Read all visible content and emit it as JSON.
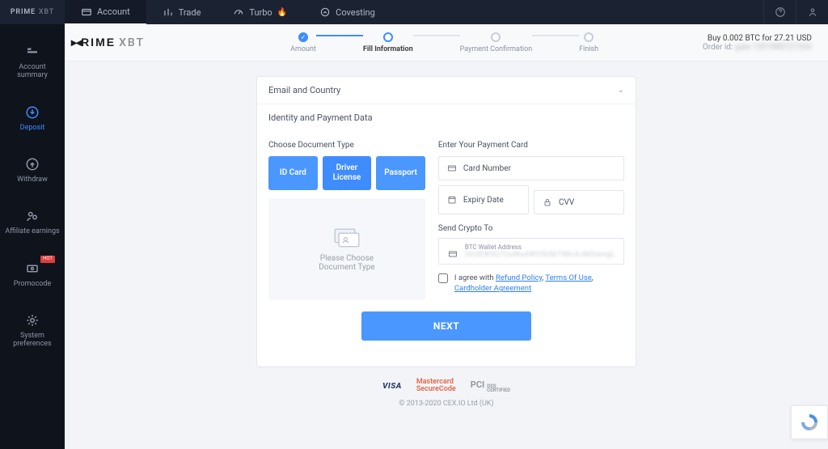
{
  "brand_top": {
    "p": "PRIME",
    "suffix": "XBT"
  },
  "topnav": {
    "account": "Account",
    "trade": "Trade",
    "turbo": "Turbo",
    "covesting": "Covesting"
  },
  "sidebar": {
    "summary": "Account\nsummary",
    "deposit": "Deposit",
    "withdraw": "Withdraw",
    "affiliate": "Affiliate earnings",
    "promo": "Promocode",
    "sys": "System\npreferences"
  },
  "logo_main": {
    "prime": "PRIME",
    "xbt": "XBT"
  },
  "stepper": {
    "s1": "Amount",
    "s2": "Fill Information",
    "s3": "Payment Confirmation",
    "s4": "Finish"
  },
  "order": {
    "buy": "Buy 0.002 BTC for 27.21 USD",
    "id_label": "Order id:",
    "id_val": "gate 1591880727350"
  },
  "sections": {
    "email_country": "Email and Country",
    "identity": "Identity and Payment Data"
  },
  "identity": {
    "doc_heading": "Choose Document Type",
    "card_heading": "Enter Your Payment Card",
    "id_card": "ID Card",
    "driver": "Driver\nLicense",
    "passport": "Passport",
    "placeholder_msg": "Please Choose\nDocument Type",
    "card_number": "Card Number",
    "expiry": "Expiry Date",
    "cvv": "CVV",
    "send_to": "Send Crypto To",
    "wallet_label": "BTC Wallet Address",
    "wallet_val": "3A3EW3U7cuWuAWtVb5bT8KrAJMOwngL",
    "agree_pre": "I agree with ",
    "refund": "Refund Policy",
    "tos": "Terms Of Use",
    "cardholder": "Cardholder Agreement"
  },
  "next": "NEXT",
  "footer": {
    "visa": "VISA",
    "mc1": "Mastercard",
    "mc2": "SecureCode",
    "pci": "PCI",
    "dss": "DSS",
    "copyright": "© 2013-2020 CEX.IO Ltd (UK)"
  }
}
